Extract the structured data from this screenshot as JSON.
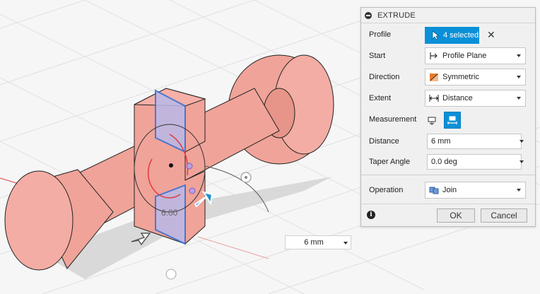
{
  "dialog": {
    "title": "EXTRUDE",
    "rows": {
      "profile": {
        "label": "Profile",
        "value": "4 selected"
      },
      "start": {
        "label": "Start",
        "value": "Profile Plane"
      },
      "direction": {
        "label": "Direction",
        "value": "Symmetric"
      },
      "extent": {
        "label": "Extent",
        "value": "Distance"
      },
      "measurement": {
        "label": "Measurement"
      },
      "distance": {
        "label": "Distance",
        "value": "6 mm"
      },
      "taper": {
        "label": "Taper Angle",
        "value": "0.0 deg"
      },
      "operation": {
        "label": "Operation",
        "value": "Join"
      }
    },
    "ok_label": "OK",
    "cancel_label": "Cancel"
  },
  "viewport": {
    "dimension_text": "6.00",
    "float_input_value": "6 mm"
  },
  "colors": {
    "accent": "#0a90d8",
    "body_fill": "#f2a59c",
    "selection_blue": "#2f6fd6"
  }
}
